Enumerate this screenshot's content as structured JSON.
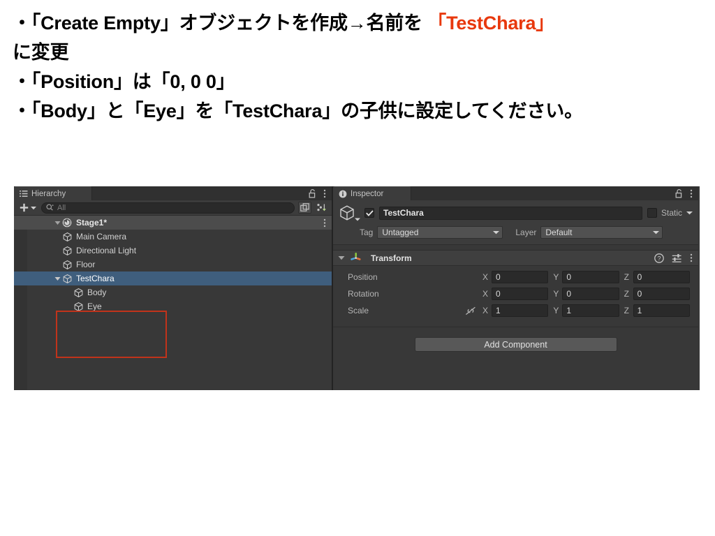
{
  "slide": {
    "lines": [
      {
        "segments": [
          {
            "text": "・「Create Empty」オブジェクトを作成→名前を ",
            "accent": false
          },
          {
            "text": "「TestChara」",
            "accent": true
          }
        ]
      },
      {
        "segments": [
          {
            "text": "に変更",
            "accent": false
          }
        ]
      },
      {
        "segments": [
          {
            "text": "・「Position」は「0, 0 0」",
            "accent": false
          }
        ]
      },
      {
        "segments": [
          {
            "text": "・「Body」と「Eye」を「TestChara」の子供に設定してください。",
            "accent": false
          }
        ]
      }
    ],
    "accent_color": "#e8380d"
  },
  "hierarchy": {
    "tab_label": "Hierarchy",
    "tab_icon": "list-icon",
    "lock_icon": "padlock-unlocked-icon",
    "menu_icon": "kebab-menu-icon",
    "toolbar": {
      "create_label": "+",
      "create_dropdown_icon": "chevron-down-icon",
      "search_placeholder": "All",
      "search_value": "",
      "search_icon": "search-icon",
      "scene_search_icon": "search-in-scene-icon",
      "sort_icon": "alphabetical-sort-icon"
    },
    "scene": {
      "name": "Stage1*",
      "icon": "unity-scene-icon",
      "expanded": true,
      "menu_icon": "kebab-menu-icon"
    },
    "items": [
      {
        "name": "Main Camera",
        "icon": "gameobject-cube-icon",
        "depth": 1,
        "selected": false,
        "expandable": false
      },
      {
        "name": "Directional Light",
        "icon": "gameobject-cube-icon",
        "depth": 1,
        "selected": false,
        "expandable": false
      },
      {
        "name": "Floor",
        "icon": "gameobject-cube-icon",
        "depth": 1,
        "selected": false,
        "expandable": false
      },
      {
        "name": "TestChara",
        "icon": "gameobject-cube-icon",
        "depth": 1,
        "selected": true,
        "expandable": true
      },
      {
        "name": "Body",
        "icon": "gameobject-cube-icon",
        "depth": 2,
        "selected": false,
        "expandable": false
      },
      {
        "name": "Eye",
        "icon": "gameobject-cube-icon",
        "depth": 2,
        "selected": false,
        "expandable": false
      }
    ],
    "annotation": {
      "type": "red-rectangle",
      "color": "#c1331b"
    },
    "selection_color": "#3f5e7d"
  },
  "inspector": {
    "tab_label": "Inspector",
    "tab_icon": "info-circle-icon",
    "lock_icon": "padlock-unlocked-icon",
    "menu_icon": "kebab-menu-icon",
    "object_icon": "gameobject-cube-icon",
    "enabled_checkbox": true,
    "name_value": "TestChara",
    "name_placeholder": "Name",
    "static_label": "Static",
    "static_checked": false,
    "static_dropdown_icon": "chevron-down-icon",
    "tag_label": "Tag",
    "tag_value": "Untagged",
    "layer_label": "Layer",
    "layer_value": "Default",
    "component": {
      "title": "Transform",
      "icon": "transform-axis-gizmo-icon",
      "expanded": true,
      "help_icon": "help-question-icon",
      "preset_icon": "preset-sliders-icon",
      "menu_icon": "kebab-menu-icon",
      "rows": [
        {
          "label": "Position",
          "link_icon": "",
          "x": "0",
          "y": "0",
          "z": "0"
        },
        {
          "label": "Rotation",
          "link_icon": "",
          "x": "0",
          "y": "0",
          "z": "0"
        },
        {
          "label": "Scale",
          "link_icon": "broken-link-icon",
          "x": "1",
          "y": "1",
          "z": "1"
        }
      ],
      "axis_labels": {
        "x": "X",
        "y": "Y",
        "z": "Z"
      }
    },
    "add_component_label": "Add Component"
  }
}
